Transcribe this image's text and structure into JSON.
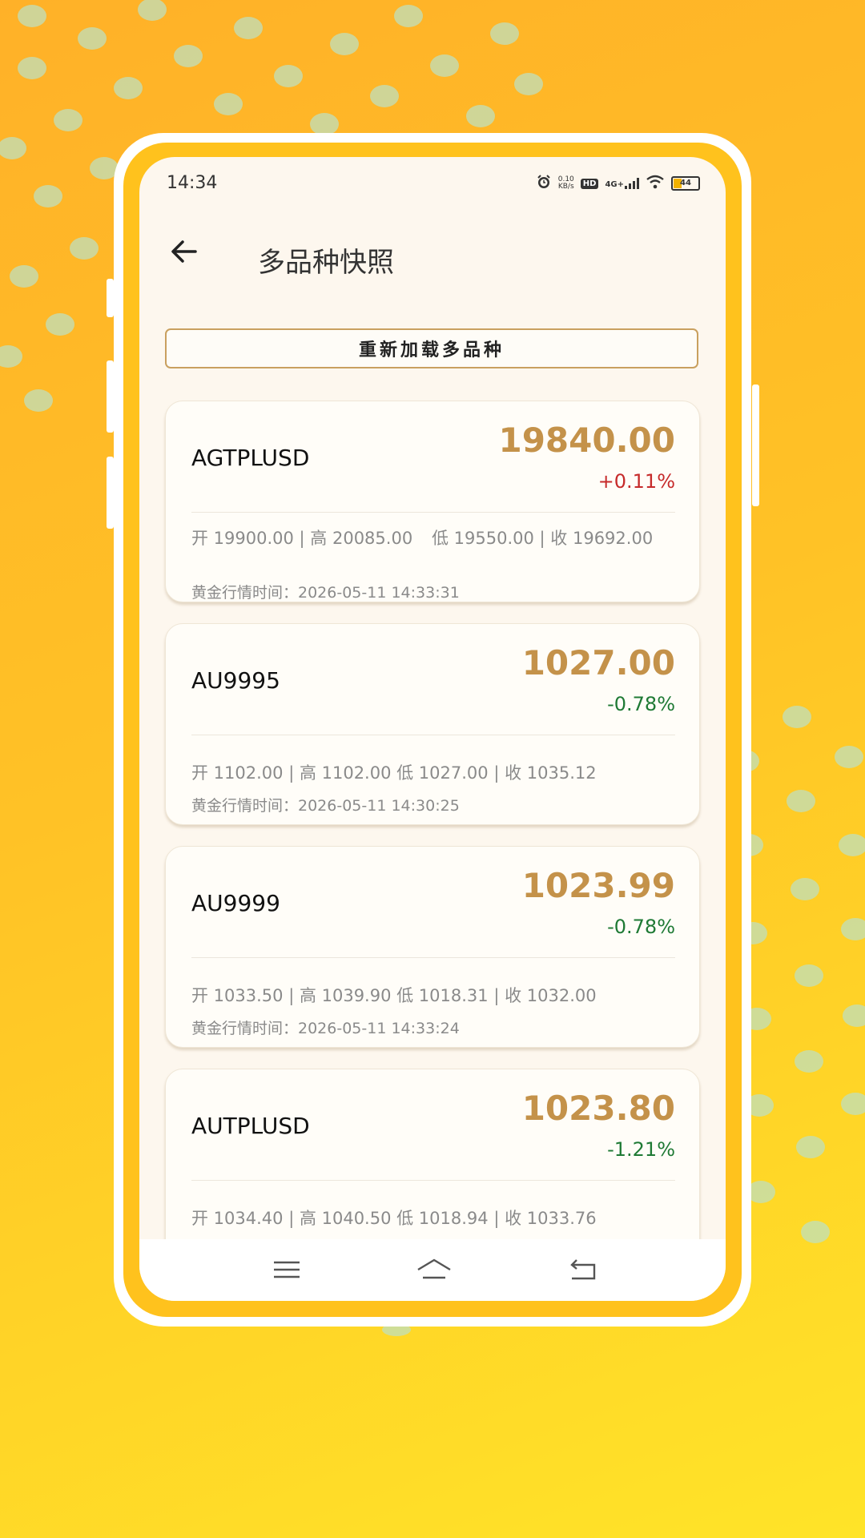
{
  "status_bar": {
    "time": "14:34",
    "net_speed_value": "0.10",
    "net_speed_unit": "KB/s",
    "hd_label": "HD",
    "signal_label": "4G+",
    "battery_level": "44",
    "icons": [
      "alarm-icon",
      "hd-icon",
      "signal-4g-icon",
      "wifi-icon",
      "battery-icon"
    ]
  },
  "header": {
    "title": "多品种快照"
  },
  "reload_button": {
    "label": "重新加载多品种"
  },
  "cards": [
    {
      "symbol": "AGTPLUSD",
      "price": "19840.00",
      "change": "+0.11%",
      "ohlc_left": "开 19900.00 | 高 20085.00",
      "ohlc_right": "低 19550.00 | 收 19692.00",
      "time": "黄金行情时间：2026-05-11 14:33:31"
    },
    {
      "symbol": "AU9995",
      "price": "1027.00",
      "change": "-0.78%",
      "ohlc": "开 1102.00 | 高 1102.00   低 1027.00 | 收 1035.12",
      "time": "黄金行情时间：2026-05-11 14:30:25"
    },
    {
      "symbol": "AU9999",
      "price": "1023.99",
      "change": "-0.78%",
      "ohlc": "开 1033.50 | 高 1039.90   低 1018.31 | 收 1032.00",
      "time": "黄金行情时间：2026-05-11 14:33:24"
    },
    {
      "symbol": "AUTPLUSD",
      "price": "1023.80",
      "change": "-1.21%",
      "ohlc": "开 1034.40 | 高 1040.50   低 1018.94 | 收 1033.76",
      "time": ""
    }
  ],
  "colors": {
    "price": "#c4924a",
    "positive": "#c62b2b",
    "negative": "#1f7a35",
    "background_top": "#ffb128",
    "background_bottom": "#ffe428"
  }
}
